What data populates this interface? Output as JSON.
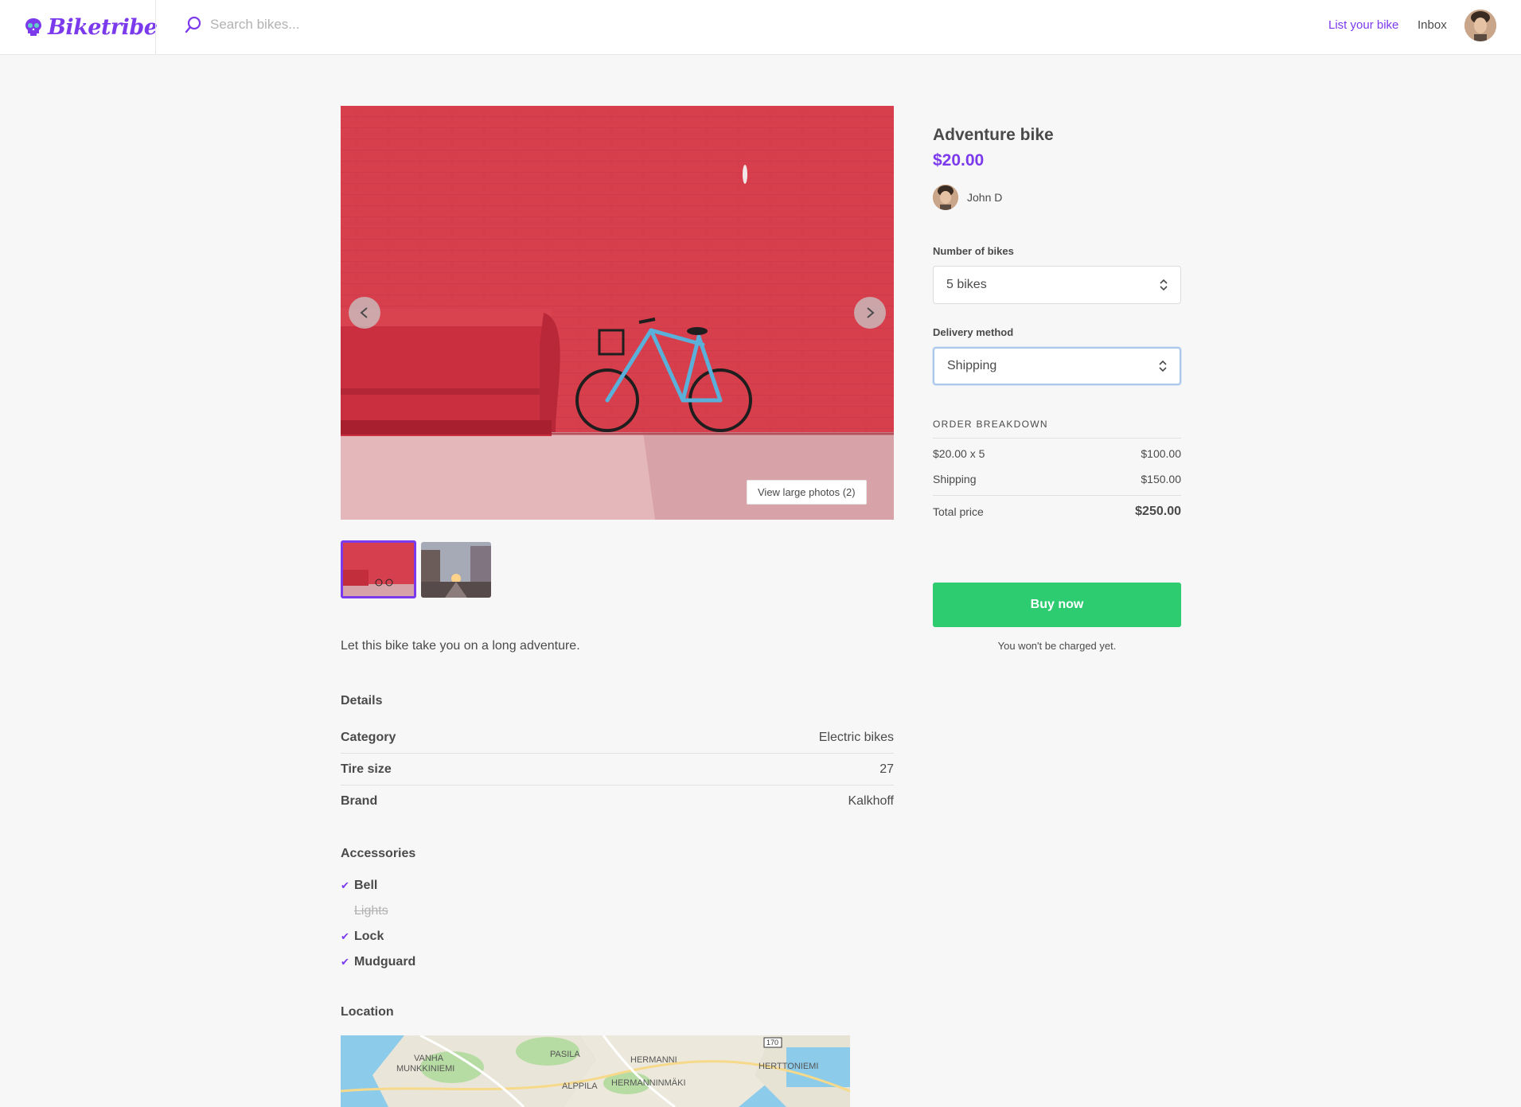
{
  "header": {
    "logo_text": "Biketribe",
    "search_placeholder": "Search bikes...",
    "nav_list": "List your bike",
    "nav_inbox": "Inbox"
  },
  "gallery": {
    "view_photos_label": "View large photos (2)"
  },
  "listing": {
    "description": "Let this bike take you on a long adventure.",
    "details_title": "Details",
    "details": [
      {
        "key": "Category",
        "value": "Electric bikes"
      },
      {
        "key": "Tire size",
        "value": "27"
      },
      {
        "key": "Brand",
        "value": "Kalkhoff"
      }
    ],
    "accessories_title": "Accessories",
    "accessories": [
      {
        "label": "Bell",
        "available": true
      },
      {
        "label": "Lights",
        "available": false
      },
      {
        "label": "Lock",
        "available": true
      },
      {
        "label": "Mudguard",
        "available": true
      }
    ],
    "location_title": "Location",
    "map_labels": [
      "VANHA",
      "MUNKKINIEMI",
      "PASILA",
      "HERMANNI",
      "HERMANNINMÄKI",
      "ALPPILA",
      "HERTTONIEMI",
      "170"
    ]
  },
  "order": {
    "title": "Adventure bike",
    "price": "$20.00",
    "author": "John D",
    "bikes_label": "Number of bikes",
    "bikes_value": "5 bikes",
    "delivery_label": "Delivery method",
    "delivery_value": "Shipping",
    "breakdown_title": "ORDER BREAKDOWN",
    "lines": [
      {
        "label": "$20.00 x 5",
        "value": "$100.00"
      },
      {
        "label": "Shipping",
        "value": "$150.00"
      }
    ],
    "total_label": "Total price",
    "total_value": "$250.00",
    "buy_label": "Buy now",
    "note": "You won't be charged yet."
  },
  "colors": {
    "accent": "#7c3aed",
    "buy": "#2ecc71",
    "text": "#4a4a4a"
  }
}
